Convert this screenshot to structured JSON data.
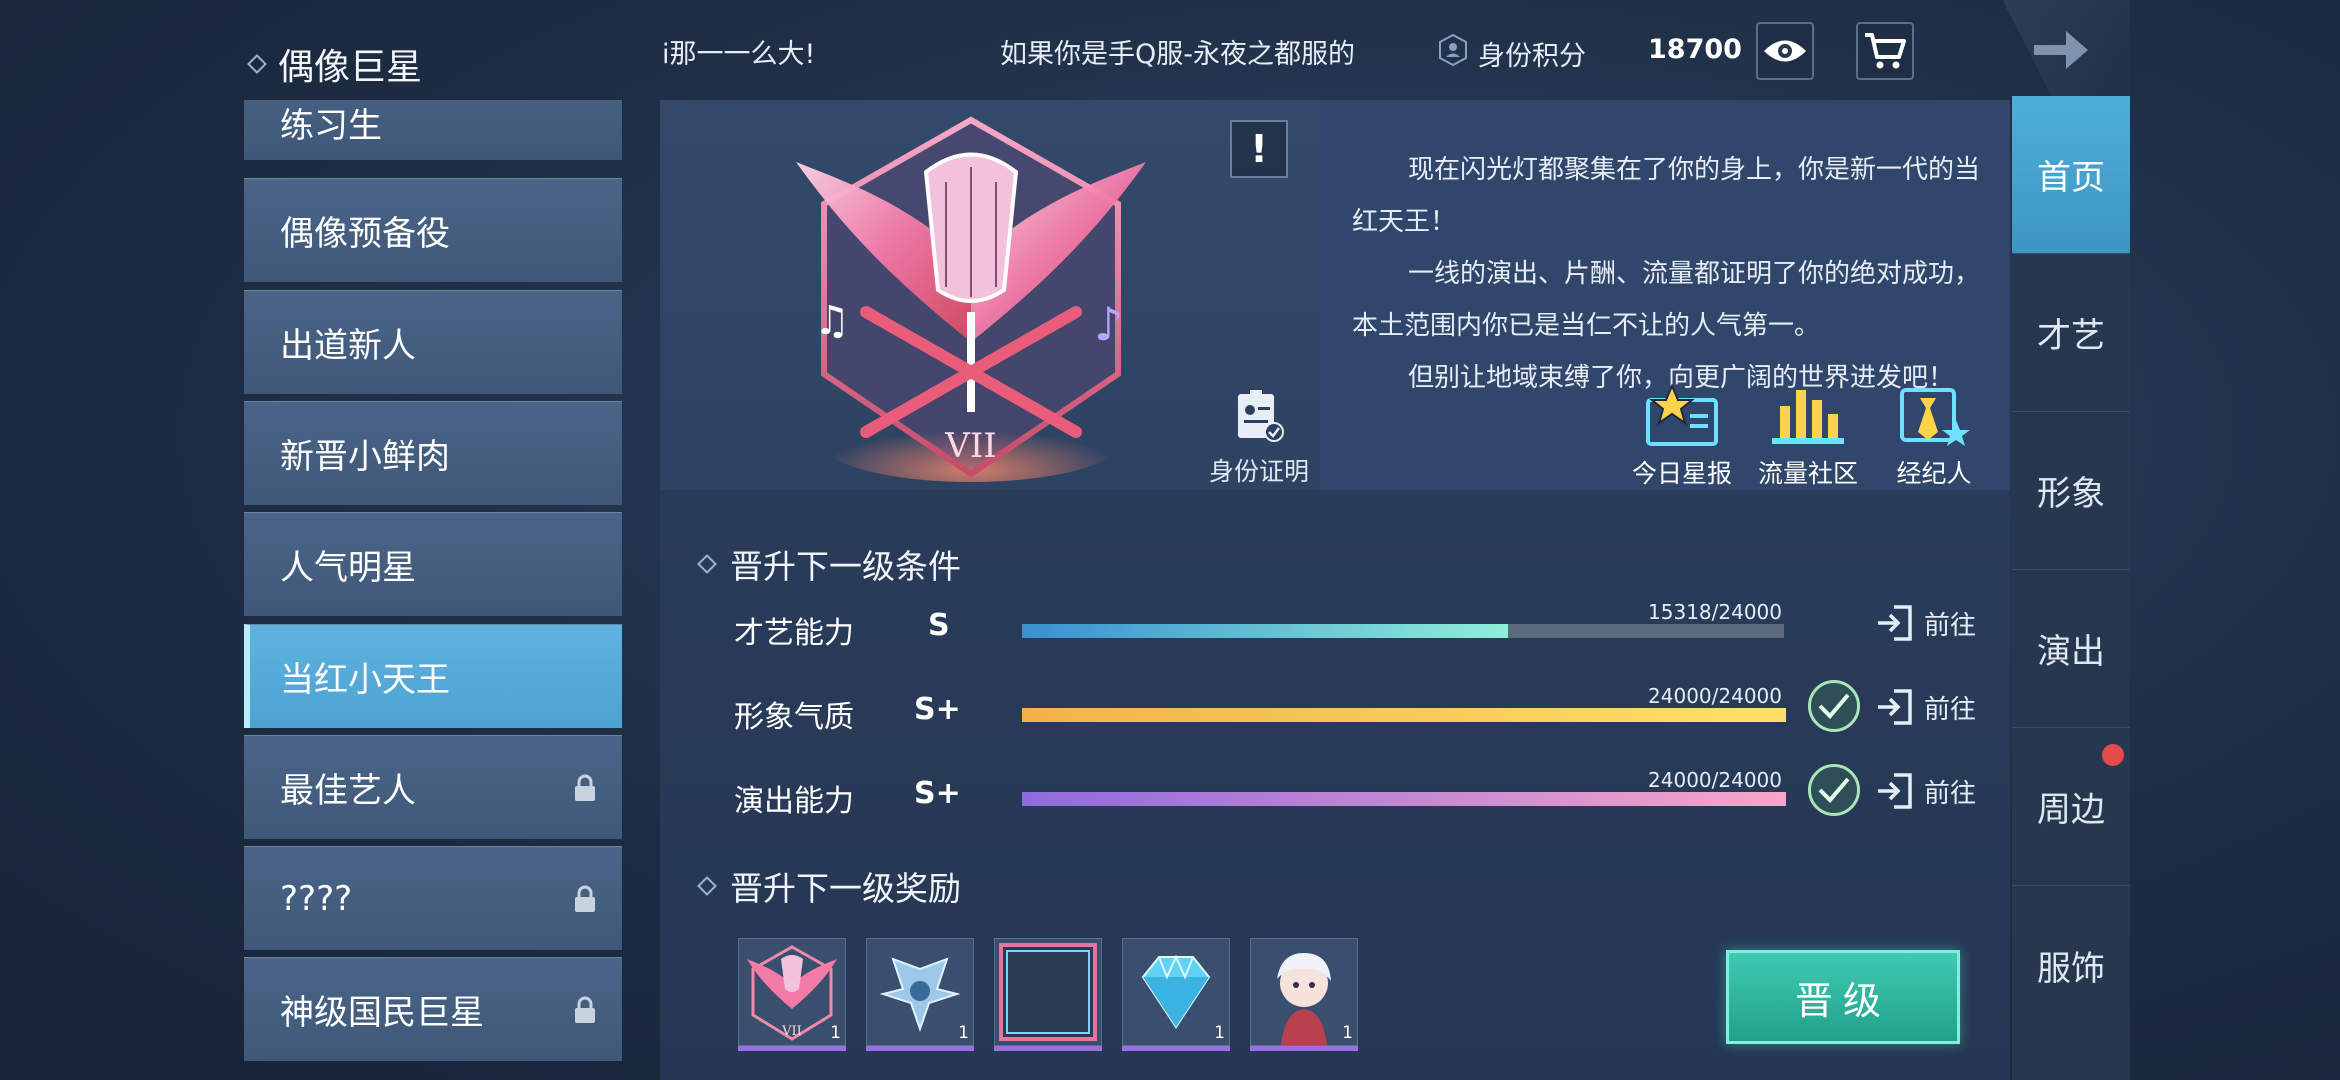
{
  "header": {
    "title": "偶像巨星",
    "marquee_left": "i那一一么大!",
    "marquee_right": "如果你是手Q服-永夜之都服的",
    "score_label": "身份积分",
    "score_value": "18700"
  },
  "levels": [
    {
      "label": "练习生",
      "locked": false
    },
    {
      "label": "偶像预备役",
      "locked": false
    },
    {
      "label": "出道新人",
      "locked": false
    },
    {
      "label": "新晋小鲜肉",
      "locked": false
    },
    {
      "label": "人气明星",
      "locked": false
    },
    {
      "label": "当红小天王",
      "locked": false,
      "active": true
    },
    {
      "label": "最佳艺人",
      "locked": true
    },
    {
      "label": "????",
      "locked": true
    },
    {
      "label": "神级国民巨星",
      "locked": true
    }
  ],
  "badge": {
    "numeral": "VII",
    "alert_symbol": "!",
    "id_cert_label": "身份证明"
  },
  "description": {
    "paragraphs": [
      "现在闪光灯都聚集在了你的身上，你是新一代的当红天王！",
      "一线的演出、片酬、流量都证明了你的绝对成功，本土范围内你已是当仁不让的人气第一。",
      "但别让地域束缚了你，向更广阔的世界进发吧！"
    ]
  },
  "quick_actions": [
    {
      "label": "今日星报",
      "icon": "star-news-icon"
    },
    {
      "label": "流量社区",
      "icon": "chart-community-icon"
    },
    {
      "label": "经纪人",
      "icon": "agent-icon"
    }
  ],
  "conditions": {
    "title": "晋升下一级条件",
    "items": [
      {
        "label": "才艺能力",
        "grade": "S",
        "value_text": "15318/24000",
        "progress": 0.638,
        "done": false,
        "goto": "前往",
        "color_start": "#3a8fd0",
        "color_end": "#8ef0d8"
      },
      {
        "label": "形象气质",
        "grade": "S+",
        "value_text": "24000/24000",
        "progress": 1.0,
        "done": true,
        "goto": "前往",
        "color_start": "#f2b24a",
        "color_end": "#ffe06a"
      },
      {
        "label": "演出能力",
        "grade": "S+",
        "value_text": "24000/24000",
        "progress": 1.0,
        "done": true,
        "goto": "前往",
        "color_start": "#8e6bdc",
        "color_end": "#f8a6c8"
      }
    ]
  },
  "rewards": {
    "title": "晋升下一级奖励",
    "items": [
      {
        "icon": "badge-vii-reward-icon",
        "count": "1",
        "numeral": "VII"
      },
      {
        "icon": "wing-emblem-reward-icon",
        "count": "1"
      },
      {
        "icon": "frame-reward-icon",
        "count": ""
      },
      {
        "icon": "diamond-reward-icon",
        "count": "1"
      },
      {
        "icon": "character-reward-icon",
        "count": "1"
      }
    ]
  },
  "upgrade_label": "晋级",
  "right_tabs": [
    {
      "label": "首页",
      "active": true
    },
    {
      "label": "才艺"
    },
    {
      "label": "形象"
    },
    {
      "label": "演出"
    },
    {
      "label": "周边",
      "dot": true
    },
    {
      "label": "服饰"
    }
  ]
}
